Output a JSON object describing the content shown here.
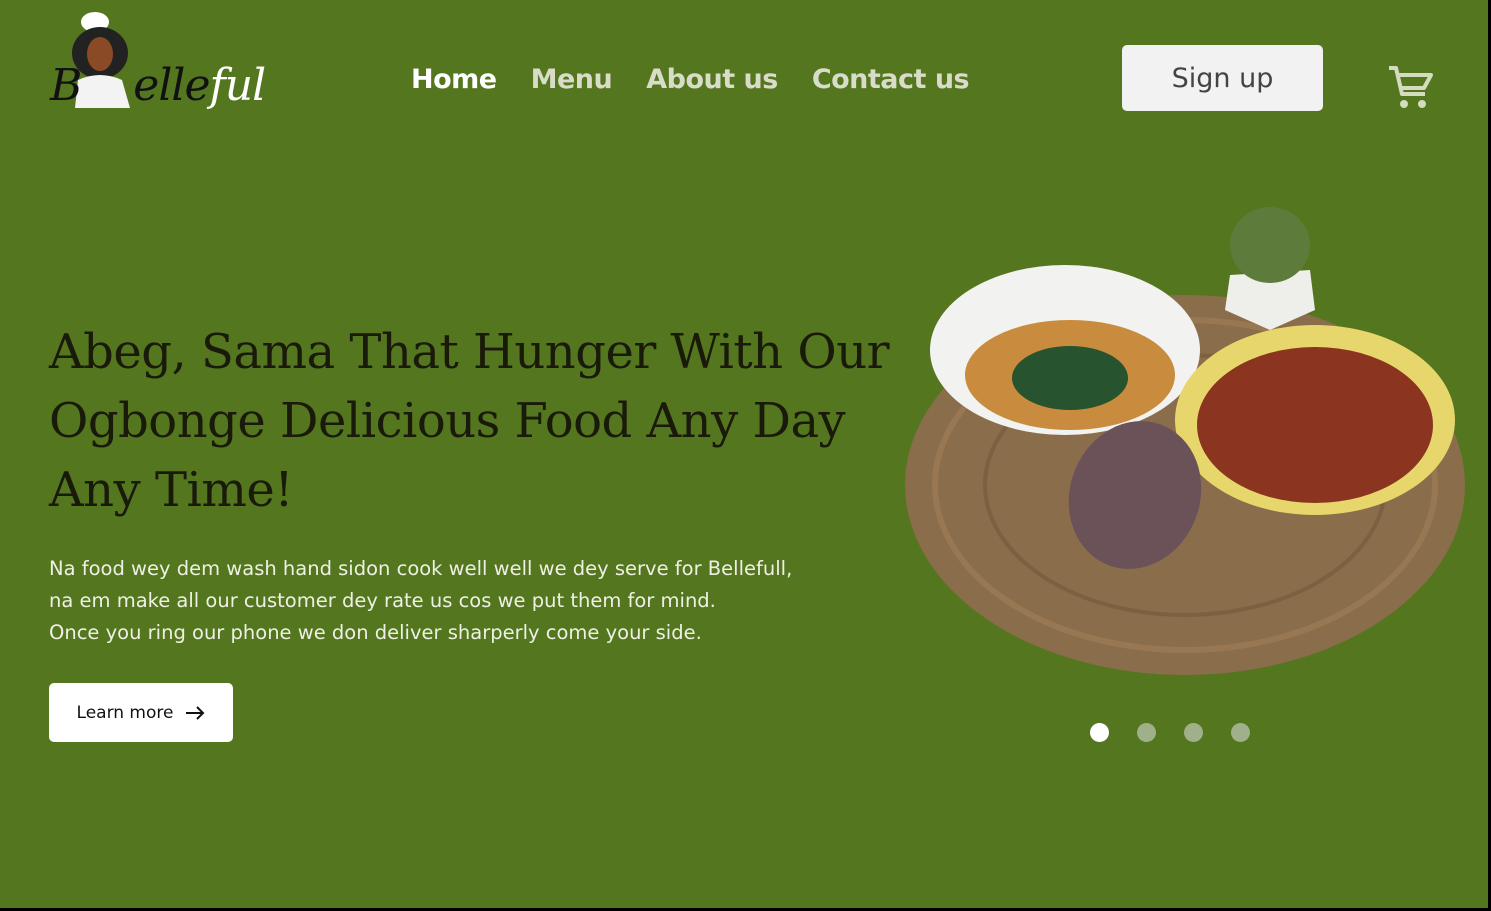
{
  "header": {
    "logo_text": "Bellefull",
    "nav": [
      {
        "label": "Home",
        "active": true
      },
      {
        "label": "Menu",
        "active": false
      },
      {
        "label": "About us",
        "active": false
      },
      {
        "label": "Contact us",
        "active": false
      }
    ],
    "signup_label": "Sign up",
    "cart_icon": "cart-icon"
  },
  "hero": {
    "title": "Abeg, Sama That Hunger With Our Ogbonge Delicious Food Any Day Any Time!",
    "description_lines": [
      "Na food wey dem wash hand sidon cook well well we dey serve for Bellefull,",
      "na em make all our customer dey rate us cos we put them for mind.",
      "Once you ring our phone we don deliver sharperly come your side."
    ],
    "cta_label": "Learn more",
    "carousel": {
      "slides": 4,
      "active_index": 0
    }
  },
  "colors": {
    "background": "#54761f",
    "button": "#f2f2f2"
  }
}
